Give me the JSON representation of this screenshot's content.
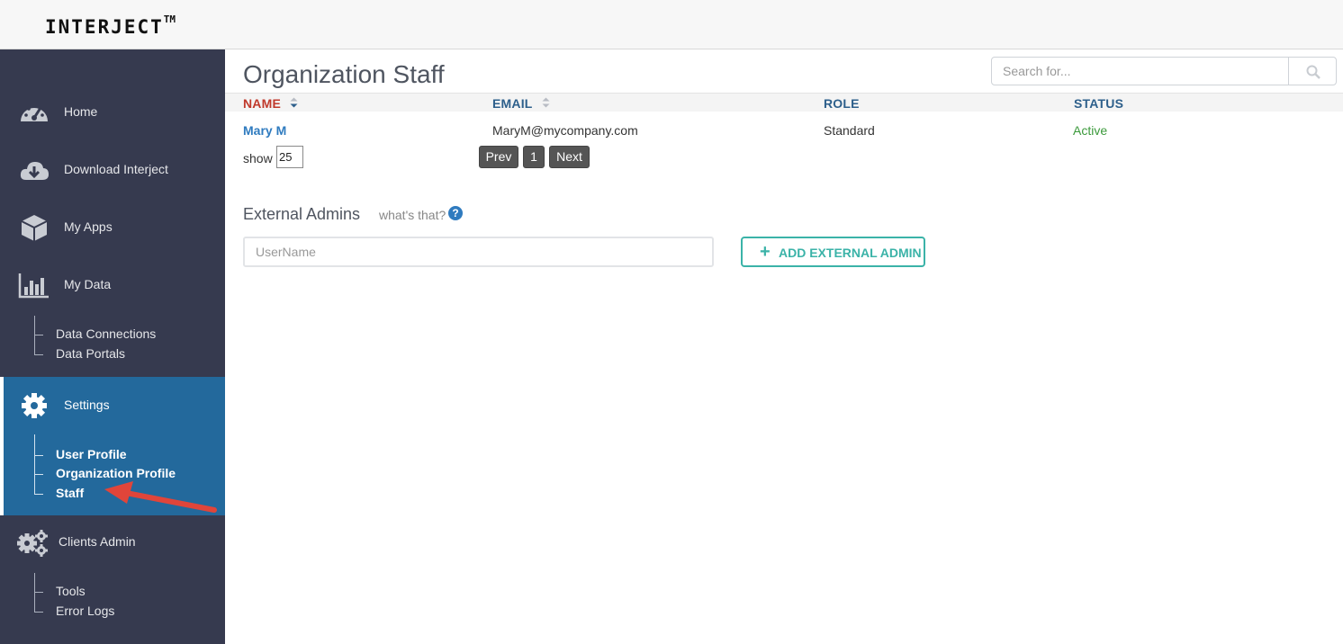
{
  "header": {
    "logo": "INTERJECT",
    "logo_tm": "TM"
  },
  "sidebar": {
    "items": [
      {
        "label": "Home",
        "icon": "dashboard-icon"
      },
      {
        "label": "Download Interject",
        "icon": "cloud-download-icon"
      },
      {
        "label": "My Apps",
        "icon": "cube-icon"
      },
      {
        "label": "My Data",
        "icon": "bar-chart-icon"
      },
      {
        "label": "Settings",
        "icon": "gear-icon"
      },
      {
        "label": "Clients Admin",
        "icon": "gears-icon"
      }
    ],
    "my_data_sub": [
      "Data Connections",
      "Data Portals"
    ],
    "settings_sub": [
      "User Profile",
      "Organization Profile",
      "Staff"
    ],
    "clients_admin_sub": [
      "Tools",
      "Error Logs"
    ]
  },
  "main": {
    "title": "Organization Staff",
    "search": {
      "placeholder": "Search for..."
    },
    "table": {
      "columns": [
        "NAME",
        "EMAIL",
        "ROLE",
        "STATUS"
      ],
      "rows": [
        {
          "name": "Mary M",
          "email": "MaryM@mycompany.com",
          "role": "Standard",
          "status": "Active"
        }
      ]
    },
    "pagination": {
      "show_label": "show",
      "page_size": "25",
      "prev": "Prev",
      "page": "1",
      "next": "Next"
    },
    "external_admins": {
      "title": "External Admins",
      "help_text": "what's that?",
      "help_glyph": "?",
      "username_placeholder": "UserName",
      "add_plus": "+",
      "add_button": "ADD EXTERNAL ADMIN"
    }
  },
  "colors": {
    "sidebar_bg": "#363a4f",
    "active_bg": "#23699c",
    "accent_teal": "#3bb3a8",
    "link_blue": "#2f7bbf",
    "status_green": "#3c9a3c",
    "sort_active": "#c0392b"
  }
}
